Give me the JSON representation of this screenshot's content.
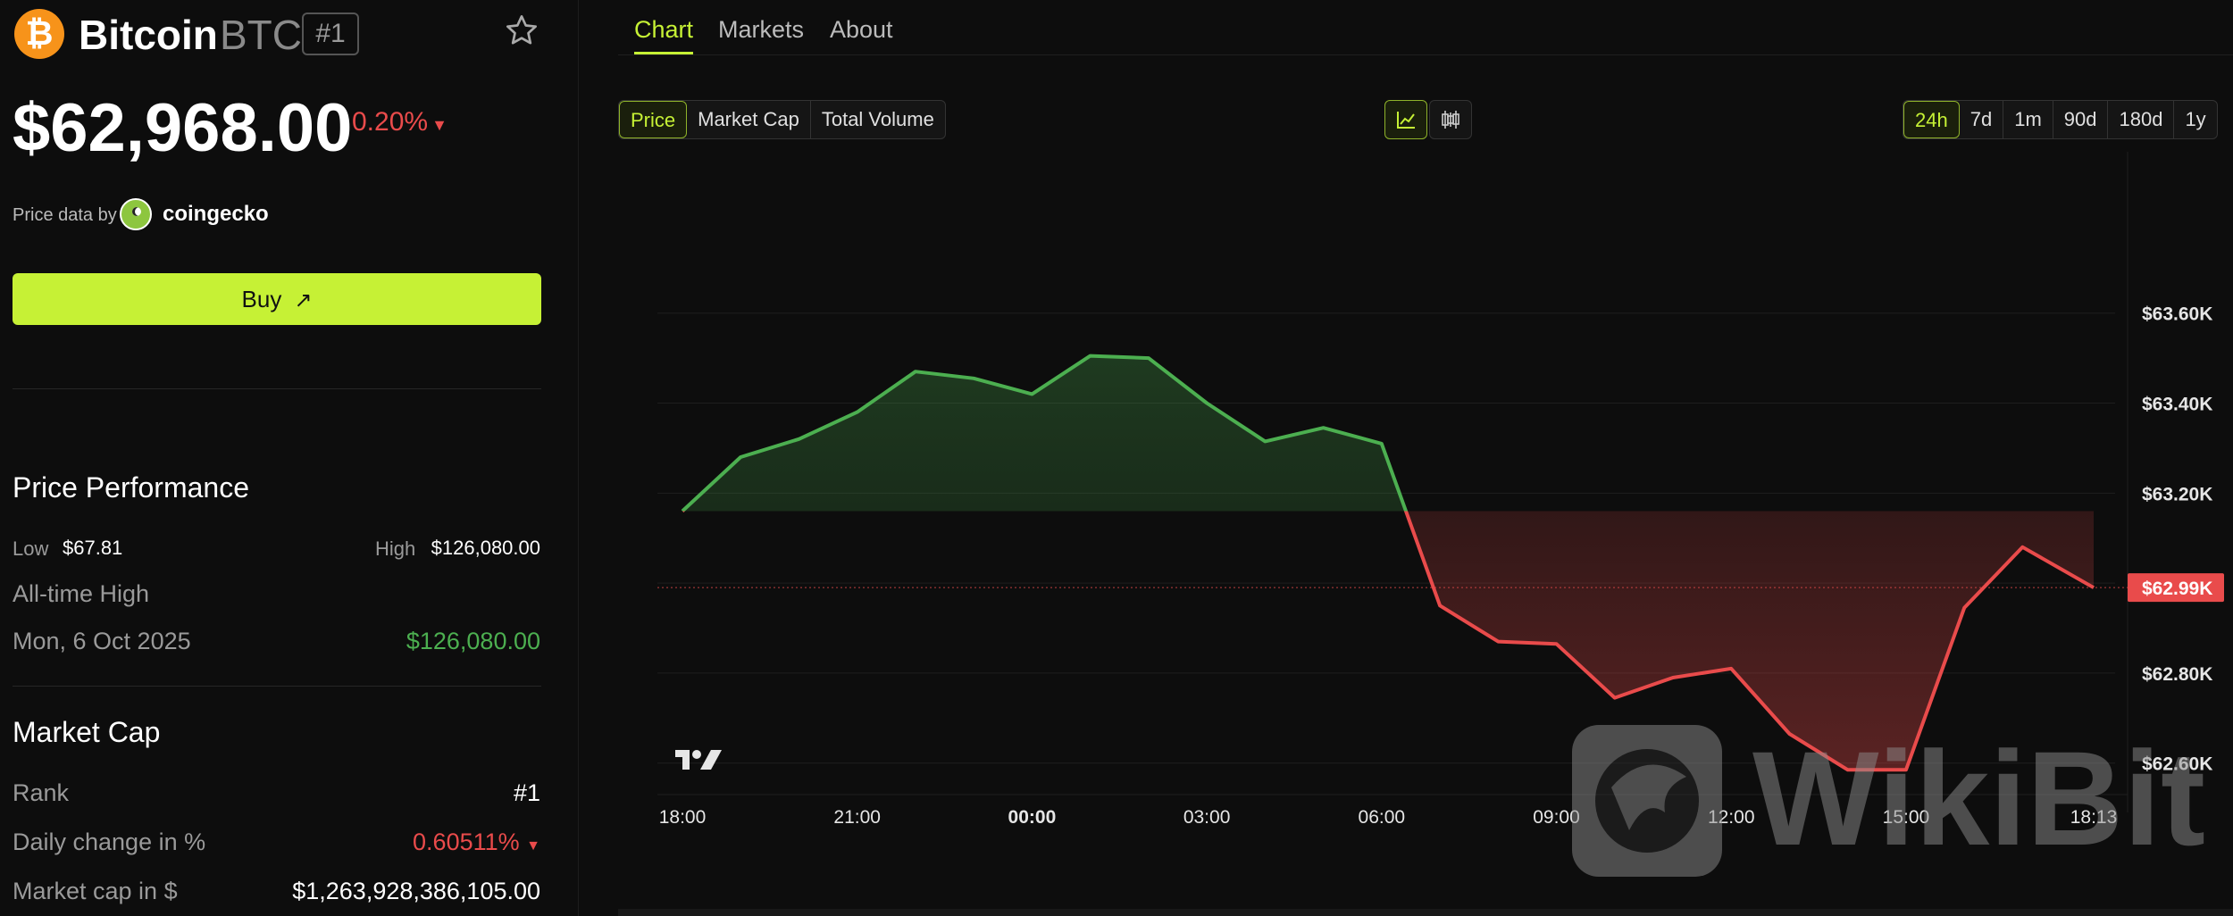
{
  "coin": {
    "logo_glyph": "₿",
    "name": "Bitcoin",
    "symbol": "BTC",
    "rank_badge": "#1",
    "price": "$62,968.00",
    "change_pct": "0.20%",
    "change_dir_glyph": "▼",
    "price_data_label": "Price data by",
    "provider": "coingecko",
    "buy_label": "Buy",
    "buy_icon_glyph": "↗"
  },
  "performance": {
    "title": "Price Performance",
    "low_label": "Low",
    "low_value": "$67.81",
    "high_label": "High",
    "high_value": "$126,080.00",
    "ath_label": "All-time High",
    "ath_date": "Mon, 6 Oct 2025",
    "ath_value": "$126,080.00"
  },
  "market_cap": {
    "title": "Market Cap",
    "rank_label": "Rank",
    "rank_value": "#1",
    "daily_change_label": "Daily change in %",
    "daily_change_value": "0.60511%",
    "daily_change_glyph": "▼",
    "cap_label": "Market cap in $",
    "cap_value": "$1,263,928,386,105.00"
  },
  "tabs": [
    "Chart",
    "Markets",
    "About"
  ],
  "active_tab": "Chart",
  "metric_options": [
    "Price",
    "Market Cap",
    "Total Volume"
  ],
  "selected_metric": "Price",
  "chart_style_icons": [
    "line-chart-icon",
    "candlestick-icon"
  ],
  "range_options": [
    "24h",
    "7d",
    "1m",
    "90d",
    "180d",
    "1y"
  ],
  "selected_range": "24h",
  "watermark": "WikiBit",
  "colors": {
    "accent": "#c6f135",
    "up": "#4caf50",
    "down": "#e94b4b",
    "bitcoin": "#f7931a",
    "background": "#0d0d0d"
  },
  "chart_data": {
    "type": "line",
    "x_labels": [
      "18:00",
      "21:00",
      "00:00",
      "03:00",
      "06:00",
      "09:00",
      "12:00",
      "15:00",
      "18:13"
    ],
    "y_ticks": [
      62600,
      62800,
      63000,
      63200,
      63400,
      63600
    ],
    "y_tick_labels": [
      "$62.60K",
      "$62.80K",
      "$63.00K",
      "$63.20K",
      "$63.40K",
      "$63.60K"
    ],
    "ylim": [
      62530,
      63780
    ],
    "baseline": 63160,
    "current_label": "$62.99K",
    "current_value": 62990,
    "x_hours": [
      0,
      1,
      2,
      3,
      4,
      5,
      6,
      7,
      8,
      9,
      10,
      11,
      12,
      13,
      14,
      15,
      16,
      17,
      18,
      19,
      20,
      21,
      22,
      23,
      24.22
    ],
    "values": [
      63160,
      63280,
      63320,
      63380,
      63470,
      63455,
      63420,
      63505,
      63500,
      63400,
      63315,
      63345,
      63310,
      62950,
      62870,
      62865,
      62745,
      62790,
      62810,
      62665,
      62585,
      62585,
      62945,
      63080,
      62990
    ],
    "ylabel": "",
    "xlabel": ""
  }
}
